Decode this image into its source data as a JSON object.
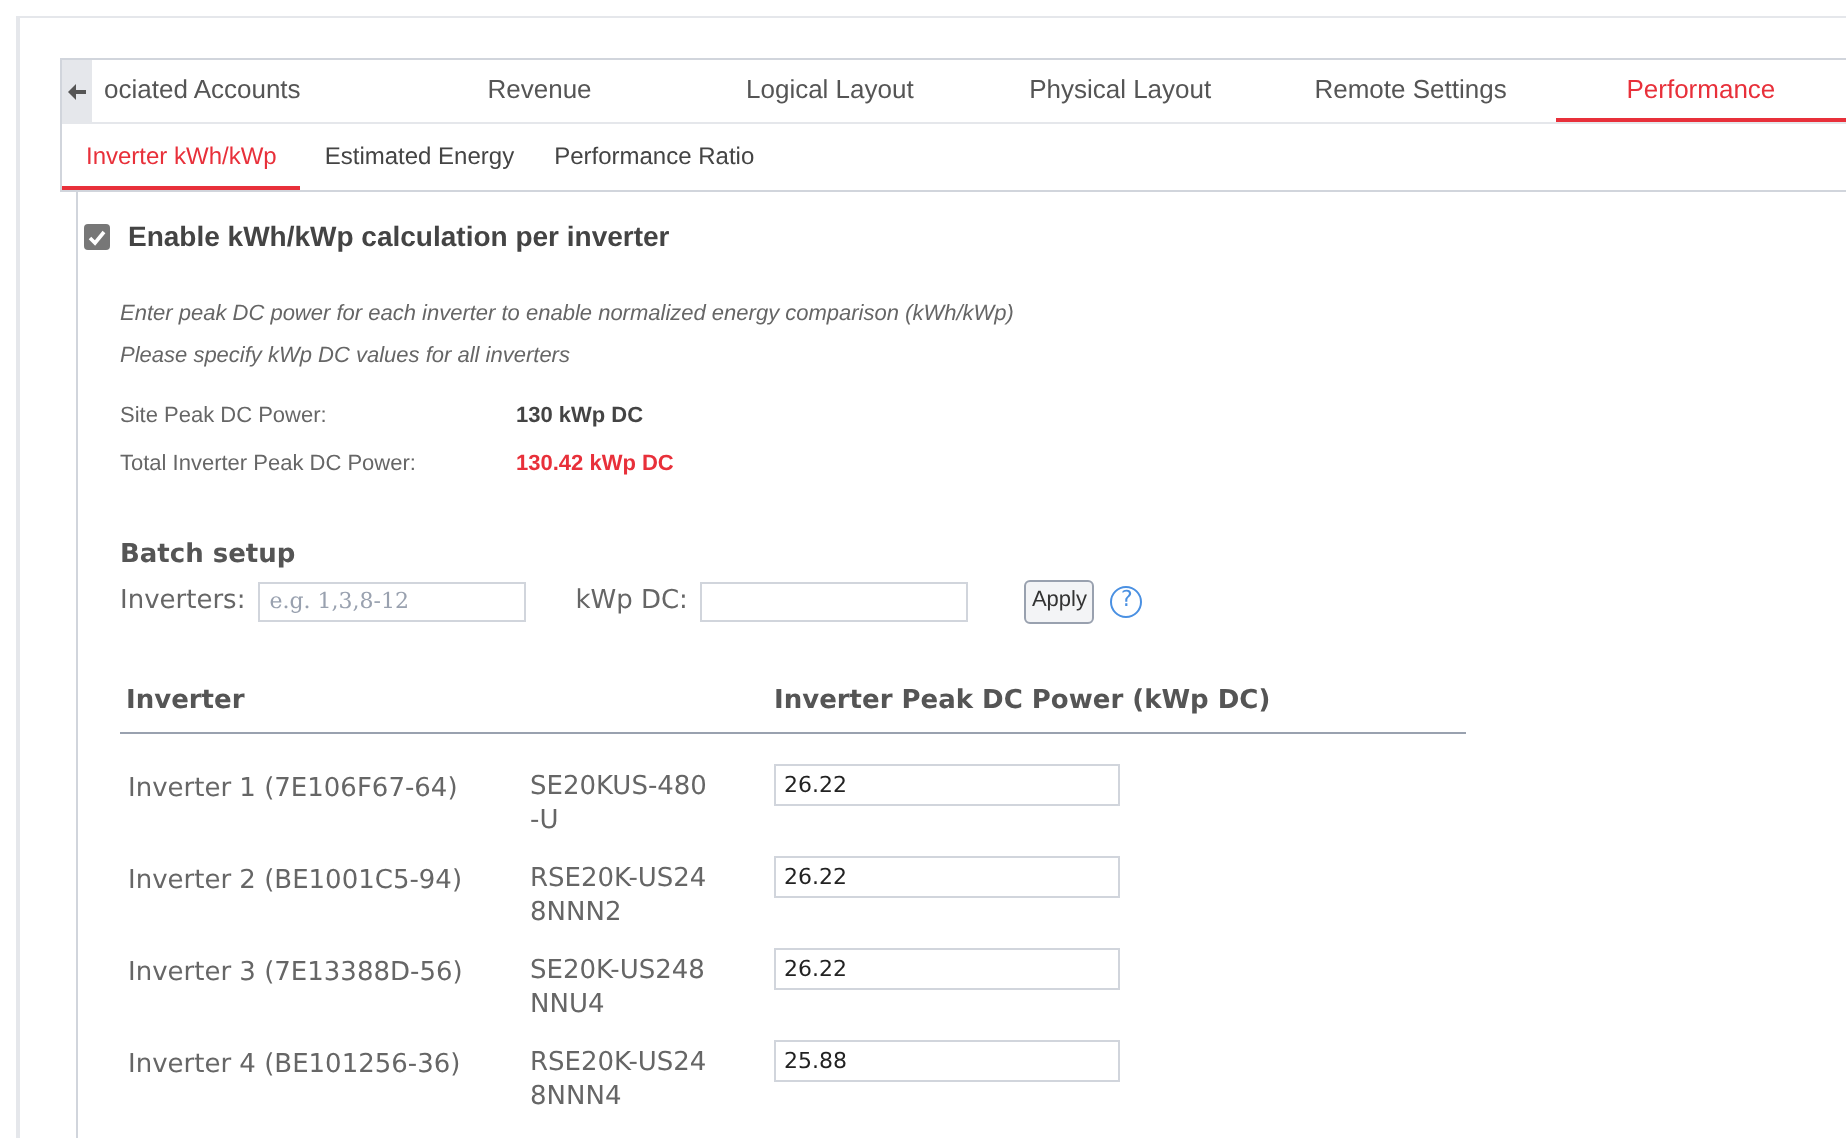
{
  "tabs": [
    {
      "label": "ociated Accounts",
      "selected": false
    },
    {
      "label": "Revenue",
      "selected": false
    },
    {
      "label": "Logical Layout",
      "selected": false
    },
    {
      "label": "Physical Layout",
      "selected": false
    },
    {
      "label": "Remote Settings",
      "selected": false
    },
    {
      "label": "Performance",
      "selected": true
    }
  ],
  "subtabs": [
    {
      "label": "Inverter kWh/kWp",
      "selected": true
    },
    {
      "label": "Estimated Energy",
      "selected": false
    },
    {
      "label": "Performance Ratio",
      "selected": false
    }
  ],
  "enable": {
    "label": "Enable kWh/kWp calculation per inverter",
    "checked": true
  },
  "notes": [
    "Enter peak DC power for each inverter to enable normalized energy comparison (kWh/kWp)",
    "Please specify kWp DC values for all inverters"
  ],
  "stats": [
    {
      "label": "Site Peak DC Power:",
      "value": "130 kWp DC",
      "warning": false
    },
    {
      "label": "Total Inverter Peak DC Power:",
      "value": "130.42 kWp DC",
      "warning": true
    }
  ],
  "batch": {
    "title": "Batch setup",
    "inverters_label": "Inverters:",
    "inverters_placeholder": "e.g. 1,3,8-12",
    "kwp_label": "kWp DC:",
    "apply": "Apply",
    "help": "?"
  },
  "table": {
    "columns": [
      "Inverter",
      "Inverter Peak DC Power (kWp DC)"
    ],
    "rows": [
      {
        "name": "Inverter 1 (7E106F67-64)",
        "model": "SE20KUS-480-U",
        "value": "26.22"
      },
      {
        "name": "Inverter 2 (BE1001C5-94)",
        "model": "RSE20K-US248NNN2",
        "value": "26.22"
      },
      {
        "name": "Inverter 3 (7E13388D-56)",
        "model": "SE20K-US248NNU4",
        "value": "26.22"
      },
      {
        "name": "Inverter 4 (BE101256-36)",
        "model": "RSE20K-US248NNN4",
        "value": "25.88"
      }
    ]
  }
}
